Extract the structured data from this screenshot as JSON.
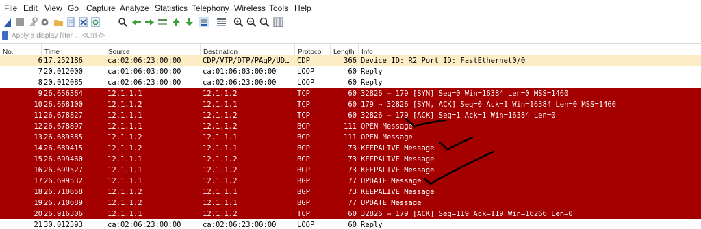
{
  "menu": [
    "File",
    "Edit",
    "View",
    "Go",
    "Capture",
    "Analyze",
    "Statistics",
    "Telephony",
    "Wireless",
    "Tools",
    "Help"
  ],
  "toolbar_icons": [
    "shark-fin-start-icon",
    "stop-square-icon",
    "restart-icon",
    "capture-options-gear-icon",
    "open-folder-icon",
    "file-icon",
    "close-x-icon",
    "reload-icon",
    "find-magnifier-icon",
    "back-arrow-icon",
    "forward-arrow-icon",
    "go-to-packet-icon",
    "go-first-icon",
    "go-last-icon",
    "autoscroll-icon",
    "colorize-icon",
    "zoom-in-icon",
    "zoom-out-icon",
    "zoom-normal-icon",
    "resize-columns-icon"
  ],
  "filter": {
    "placeholder": "Apply a display filter ... <Ctrl-/>"
  },
  "columns": [
    "No.",
    "Time",
    "Source",
    "Destination",
    "Protocol",
    "Length",
    "Info"
  ],
  "colors": {
    "selected_row": "#fcedc5",
    "white_row": "#ffffff",
    "red_row": "#a40000",
    "red_text": "#fffdfd"
  },
  "packets": [
    {
      "no": "6",
      "time": "17.252186",
      "src": "ca:02:06:23:00:00",
      "dst": "CDP/VTP/DTP/PAgP/UD…",
      "proto": "CDP",
      "len": "366",
      "info": "Device ID: R2  Port ID: FastEthernet0/0",
      "style": "selected"
    },
    {
      "no": "7",
      "time": "20.012000",
      "src": "ca:01:06:03:00:00",
      "dst": "ca:01:06:03:00:00",
      "proto": "LOOP",
      "len": "60",
      "info": "Reply",
      "style": "white"
    },
    {
      "no": "8",
      "time": "20.012085",
      "src": "ca:02:06:23:00:00",
      "dst": "ca:02:06:23:00:00",
      "proto": "LOOP",
      "len": "60",
      "info": "Reply",
      "style": "white"
    },
    {
      "no": "9",
      "time": "26.656364",
      "src": "12.1.1.1",
      "dst": "12.1.1.2",
      "proto": "TCP",
      "len": "60",
      "info": "32826 → 179 [SYN] Seq=0 Win=16384 Len=0 MSS=1460",
      "style": "red"
    },
    {
      "no": "10",
      "time": "26.668100",
      "src": "12.1.1.2",
      "dst": "12.1.1.1",
      "proto": "TCP",
      "len": "60",
      "info": "179 → 32826 [SYN, ACK] Seq=0 Ack=1 Win=16384 Len=0 MSS=1460",
      "style": "red"
    },
    {
      "no": "11",
      "time": "26.678827",
      "src": "12.1.1.1",
      "dst": "12.1.1.2",
      "proto": "TCP",
      "len": "60",
      "info": "32826 → 179 [ACK] Seq=1 Ack=1 Win=16384 Len=0",
      "style": "red"
    },
    {
      "no": "12",
      "time": "26.678897",
      "src": "12.1.1.1",
      "dst": "12.1.1.2",
      "proto": "BGP",
      "len": "111",
      "info": "OPEN Message",
      "style": "red"
    },
    {
      "no": "13",
      "time": "26.689385",
      "src": "12.1.1.2",
      "dst": "12.1.1.1",
      "proto": "BGP",
      "len": "111",
      "info": "OPEN Message",
      "style": "red"
    },
    {
      "no": "14",
      "time": "26.689415",
      "src": "12.1.1.2",
      "dst": "12.1.1.1",
      "proto": "BGP",
      "len": "73",
      "info": "KEEPALIVE Message",
      "style": "red"
    },
    {
      "no": "15",
      "time": "26.699460",
      "src": "12.1.1.1",
      "dst": "12.1.1.2",
      "proto": "BGP",
      "len": "73",
      "info": "KEEPALIVE Message",
      "style": "red"
    },
    {
      "no": "16",
      "time": "26.699527",
      "src": "12.1.1.1",
      "dst": "12.1.1.2",
      "proto": "BGP",
      "len": "73",
      "info": "KEEPALIVE Message",
      "style": "red"
    },
    {
      "no": "17",
      "time": "26.699532",
      "src": "12.1.1.1",
      "dst": "12.1.1.2",
      "proto": "BGP",
      "len": "77",
      "info": "UPDATE Message",
      "style": "red"
    },
    {
      "no": "18",
      "time": "26.710658",
      "src": "12.1.1.2",
      "dst": "12.1.1.1",
      "proto": "BGP",
      "len": "73",
      "info": "KEEPALIVE Message",
      "style": "red"
    },
    {
      "no": "19",
      "time": "26.710689",
      "src": "12.1.1.2",
      "dst": "12.1.1.1",
      "proto": "BGP",
      "len": "77",
      "info": "UPDATE Message",
      "style": "red"
    },
    {
      "no": "20",
      "time": "26.916306",
      "src": "12.1.1.1",
      "dst": "12.1.1.2",
      "proto": "TCP",
      "len": "60",
      "info": "32826 → 179 [ACK] Seq=119 Ack=119 Win=16266 Len=0",
      "style": "red"
    },
    {
      "no": "21",
      "time": "30.012393",
      "src": "ca:02:06:23:00:00",
      "dst": "ca:02:06:23:00:00",
      "proto": "LOOP",
      "len": "60",
      "info": "Reply",
      "style": "white"
    }
  ]
}
